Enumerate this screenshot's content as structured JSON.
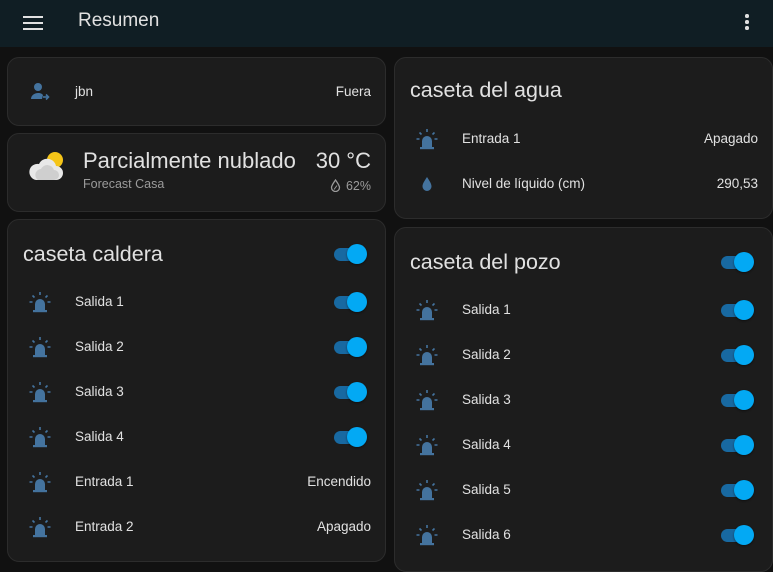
{
  "header": {
    "title": "Resumen",
    "menu_icon": "menu-icon",
    "overflow_icon": "dots-vertical-icon"
  },
  "colors": {
    "toggle_on": "#03a9f4",
    "track_on": "#1869a1",
    "icon": "#44739e",
    "card_bg": "#1c1c1c",
    "page_bg": "#111111",
    "header_bg": "#101e24"
  },
  "person": {
    "name": "jbn",
    "state": "Fuera",
    "icon": "account-arrow-right-icon"
  },
  "weather": {
    "condition": "Parcialmente nublado",
    "temperature": "30 °C",
    "location": "Forecast Casa",
    "humidity": "62%",
    "icon": "partly-cloudy-icon"
  },
  "caldera": {
    "title": "caseta caldera",
    "header_toggle_on": true,
    "rows": [
      {
        "label": "Salida 1",
        "type": "toggle",
        "on": true
      },
      {
        "label": "Salida 2",
        "type": "toggle",
        "on": true
      },
      {
        "label": "Salida 3",
        "type": "toggle",
        "on": true
      },
      {
        "label": "Salida 4",
        "type": "toggle",
        "on": true
      },
      {
        "label": "Entrada 1",
        "type": "state",
        "state": "Encendido"
      },
      {
        "label": "Entrada 2",
        "type": "state",
        "state": "Apagado"
      }
    ]
  },
  "agua": {
    "title": "caseta del agua",
    "rows": [
      {
        "label": "Entrada 1",
        "state": "Apagado",
        "icon": "alarm-light-icon"
      },
      {
        "label": "Nivel de líquido (cm)",
        "state": "290,53",
        "icon": "water-drop-icon"
      }
    ]
  },
  "pozo": {
    "title": "caseta del pozo",
    "header_toggle_on": true,
    "rows": [
      {
        "label": "Salida 1",
        "on": true
      },
      {
        "label": "Salida 2",
        "on": true
      },
      {
        "label": "Salida 3",
        "on": true
      },
      {
        "label": "Salida 4",
        "on": true
      },
      {
        "label": "Salida 5",
        "on": true
      },
      {
        "label": "Salida 6",
        "on": true
      }
    ]
  }
}
